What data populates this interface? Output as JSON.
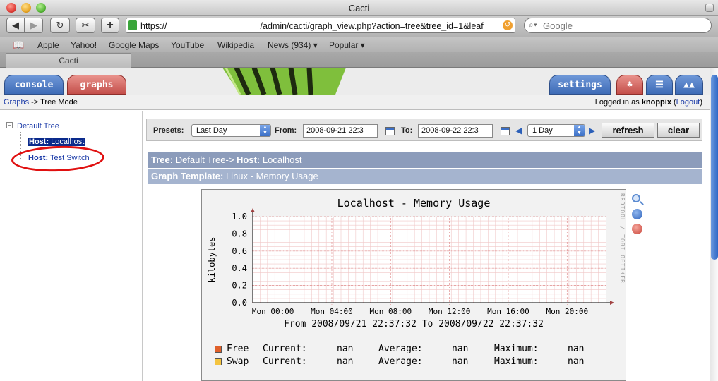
{
  "browser": {
    "window_title": "Cacti",
    "url_prefix": "https://",
    "url_path": "/admin/cacti/graph_view.php?action=tree&tree_id=1&leaf",
    "search_placeholder": "Google",
    "bookmarks": [
      "Apple",
      "Yahoo!",
      "Google Maps",
      "YouTube",
      "Wikipedia",
      "News (934) ▾",
      "Popular ▾"
    ],
    "tab_label": "Cacti"
  },
  "cacti": {
    "tabs": {
      "console": "console",
      "graphs": "graphs",
      "settings": "settings"
    },
    "breadcrumb": {
      "link": "Graphs",
      "separator": " -> ",
      "current": "Tree Mode"
    },
    "login": {
      "prefix": "Logged in as ",
      "user": "knoppix",
      "logout_open": " (",
      "logout": "Logout",
      "logout_close": ")"
    },
    "tree": {
      "root": "Default Tree",
      "toggle": "−",
      "hosts": [
        {
          "prefix": "Host:",
          "name": "Localhost"
        },
        {
          "prefix": "Host:",
          "name": "Test Switch"
        }
      ]
    },
    "filter": {
      "presets_label": "Presets:",
      "presets_value": "Last Day",
      "from_label": "From:",
      "from_value": "2008-09-21 22:3",
      "to_label": "To:",
      "to_value": "2008-09-22 22:3",
      "span_value": "1 Day",
      "refresh": "refresh",
      "clear": "clear"
    },
    "tree_bar": {
      "tree_label": "Tree:",
      "tree_value": " Default Tree-> ",
      "host_label": "Host:",
      "host_value": " Localhost"
    },
    "template_bar": {
      "label": "Graph Template:",
      "value": " Linux - Memory Usage"
    },
    "watermark": "RRDTOOL / TOBI OETIKER"
  },
  "chart_data": {
    "type": "line",
    "title": "Localhost - Memory Usage",
    "ylabel": "kilobytes",
    "xlabel": "",
    "ylim": [
      0,
      1.0
    ],
    "y_ticks": [
      "1.0",
      "0.8",
      "0.6",
      "0.4",
      "0.2",
      "0.0"
    ],
    "x_ticks": [
      "Mon 00:00",
      "Mon 04:00",
      "Mon 08:00",
      "Mon 12:00",
      "Mon 16:00",
      "Mon 20:00"
    ],
    "grid": true,
    "range_text": "From 2008/09/21 22:37:32 To 2008/09/22 22:37:32",
    "series": [
      {
        "name": "Free",
        "color": "#e0602a",
        "current": "nan",
        "average": "nan",
        "maximum": "nan"
      },
      {
        "name": "Swap",
        "color": "#f4c440",
        "current": "nan",
        "average": "nan",
        "maximum": "nan"
      }
    ],
    "stat_labels": {
      "current": "Current:",
      "average": "Average:",
      "maximum": "Maximum:"
    }
  },
  "colors": {
    "tree_bar": "#8c9cbb",
    "template_bar": "#a5b4cf",
    "annotation": "#e01010",
    "grid_minor": "#f0c8c8",
    "grid_major": "#e09090"
  }
}
